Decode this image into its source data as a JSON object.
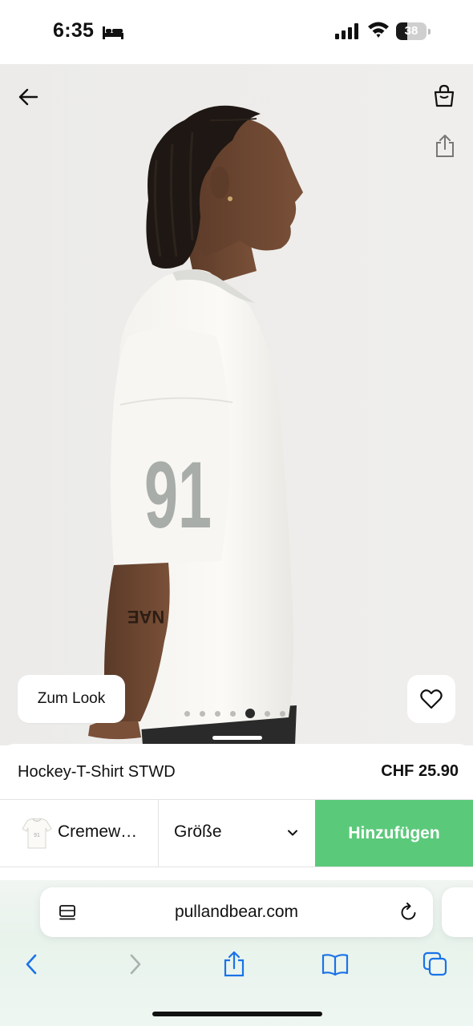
{
  "status_bar": {
    "time": "6:35",
    "battery_level": "38",
    "battery_fraction": 0.38,
    "icons": [
      "bed-icon",
      "cellular-signal-icon",
      "wifi-icon",
      "battery-icon"
    ]
  },
  "header": {
    "icons": [
      "back-arrow-icon",
      "shopping-bag-icon",
      "share-icon"
    ]
  },
  "gallery": {
    "jersey_number": "91",
    "tattoo_text": "NAE",
    "dot_count": 7,
    "active_index": 4,
    "look_label": "Zum Look",
    "favorite_icon": "heart-icon"
  },
  "product": {
    "name": "Hockey-T-Shirt STWD",
    "price": "CHF 25.90",
    "color_label": "Cremew…",
    "size_label": "Größe",
    "add_label": "Hinzufügen",
    "accent_color": "#5bc97a"
  },
  "browser": {
    "url": "pullandbear.com",
    "toolbar_icons": [
      "back-icon",
      "forward-icon",
      "share-icon",
      "bookmarks-icon",
      "tabs-icon"
    ],
    "accent_color": "#1a73e8"
  }
}
